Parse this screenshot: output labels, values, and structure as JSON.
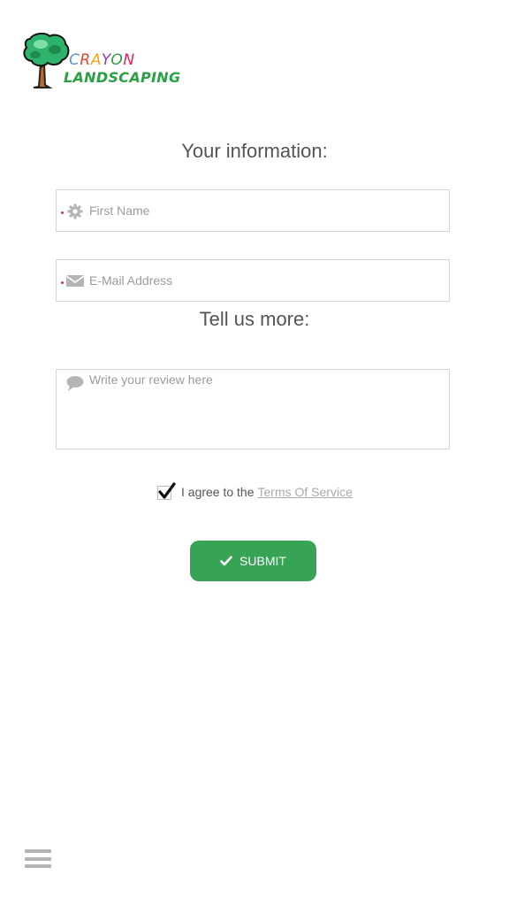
{
  "brand": {
    "word1": "CRAYON",
    "word2": "LANDSCAPING",
    "colors": [
      "#5b8fd6",
      "#e8432b",
      "#f0a51e",
      "#8a3fb5",
      "#2aa043",
      "#e0245e"
    ]
  },
  "section_info": {
    "title": "Your information:"
  },
  "first_name": {
    "placeholder": "First Name",
    "value": "",
    "icon": "gear-icon"
  },
  "email": {
    "placeholder": "E-Mail Address",
    "value": "",
    "icon": "envelope-icon"
  },
  "section_more": {
    "title": "Tell us more:"
  },
  "review": {
    "placeholder": "Write your review here",
    "value": "",
    "icon": "speech-bubble-icon"
  },
  "terms": {
    "checked": true,
    "text": "I agree to the",
    "link": "Terms Of Service"
  },
  "submit": {
    "label": "SUBMIT",
    "color": "#37a354",
    "icon": "check-icon"
  },
  "menu": {
    "icon": "hamburger-menu-icon"
  }
}
